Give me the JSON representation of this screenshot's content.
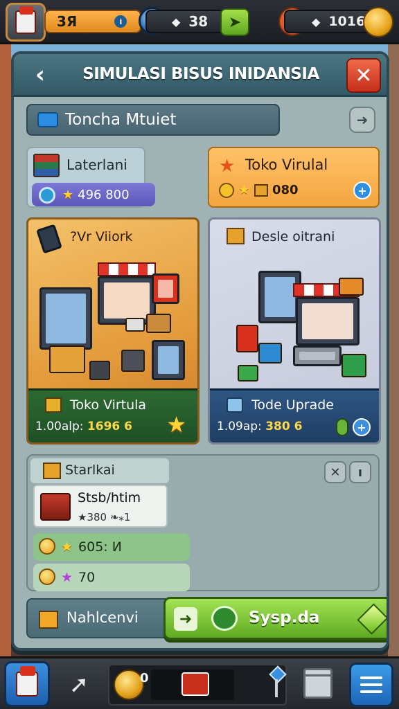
{
  "hud": {
    "level": "3Я",
    "gems": "38",
    "coins": "1016",
    "icons": [
      "avatar-icon",
      "gem-icon",
      "plus-icon",
      "bag-icon",
      "coin-stack-icon"
    ]
  },
  "panel": {
    "title": "SIMULASI BISUS INIDANSIA",
    "back_glyph": "‹",
    "close_glyph": "✕",
    "search_text": "Toncha Mtuiet",
    "nav_glyph": "➜"
  },
  "cards_small": {
    "laterlani": {
      "label": "Laterlani",
      "value": "496 800"
    },
    "toko": {
      "label": "Toko Virulal",
      "value": "080"
    }
  },
  "cards_big": {
    "left": {
      "title": "?Vr Viiork",
      "footer_name": "Toko Virtula",
      "footer_price_label": "1.00alp:",
      "footer_price_value": "1696 6"
    },
    "right": {
      "title": "Desle oitrani",
      "footer_name": "Tode Uprade",
      "footer_price_label": "1.09ap:",
      "footer_price_value": "380 6"
    }
  },
  "stats": {
    "header": "Starlkai",
    "item_name": "Stsb/htim",
    "item_stats": "★380 ❧⁎1",
    "row1_value": "605: И",
    "row2_value": "70"
  },
  "action": {
    "label": "Nahlcenvi",
    "button": "Sysp.da"
  },
  "bottom_nav": {
    "coin_count": "0",
    "arrow_glyph": "➚"
  },
  "colors": {
    "accent_green": "#5faa22",
    "accent_blue": "#1d66b8",
    "accent_orange": "#e08a1f",
    "close_red": "#c62f1c"
  }
}
